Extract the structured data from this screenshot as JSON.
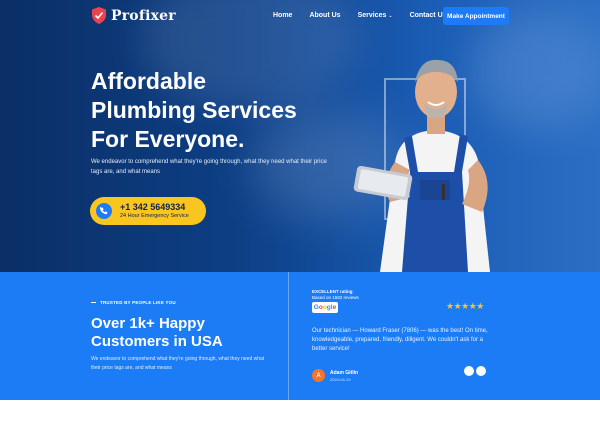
{
  "nav": {
    "logo_text": "Profixer",
    "links": [
      {
        "label": "Home"
      },
      {
        "label": "About Us"
      },
      {
        "label": "Services",
        "has_dropdown": true
      },
      {
        "label": "Contact Us"
      }
    ],
    "cta_label": "Make Appointment"
  },
  "hero": {
    "title_lines": [
      "Affordable",
      "Plumbing Services",
      "For Everyone."
    ],
    "description": "We endeavor to comprehend what they're going through, what they need what their price tags are, and what means",
    "phone_number": "+1 342 5649334",
    "phone_subtext": "24 Hour Emergency Service"
  },
  "trust": {
    "eyebrow": "TRUSTED BY PEOPLE LIKE YOU",
    "title": "Over 1k+ Happy Customers in USA",
    "description": "We endeavor to comprehend what they're going through, what they need what their price tags are, and what means"
  },
  "rating": {
    "label": "EXCELLENT rating",
    "based_on": "Based on 1582 reviews",
    "provider": "Google",
    "stars": "★★★★★",
    "review_text": "Our technician — Howard Fraser (7806) — was the best! On time, knowledgeable, prepared, friendly, diligent. We couldn't ask for a better service!",
    "author_initial": "A",
    "author_name": "Adam Gitlin",
    "date": "2024-04-19"
  },
  "colors": {
    "accent_blue": "#1b7cf5",
    "cta_yellow": "#f9c51f",
    "hero_dark": "#0b2f66"
  }
}
